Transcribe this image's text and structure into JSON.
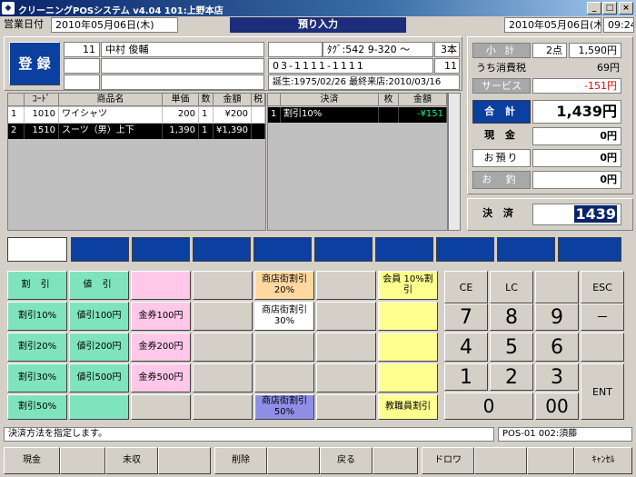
{
  "window": {
    "title": "クリーニングPOSシステム v4.04 101:上野本店",
    "min": "_",
    "max": "□",
    "close": "×"
  },
  "topbar": {
    "business_date_label": "営業日付",
    "business_date": "2010年05月06日(木)",
    "screen_title": "預り入力",
    "current_date": "2010年05月06日(木)",
    "time": "09:24"
  },
  "customer": {
    "register_label": "登 録",
    "number": "11",
    "name": "中村 俊輔",
    "tag_label": "ﾀｸﾞ:542 9-320 ～",
    "pieces": "3本",
    "phone": "03-1111-1111",
    "phone_ext": "11",
    "birth_last_visit": "誕生:1975/02/26 最終来店:2010/03/16"
  },
  "items_table": {
    "headers": [
      "ｺｰﾄﾞ",
      "商品名",
      "単価",
      "数",
      "金額",
      "税"
    ],
    "rows": [
      {
        "no": "1",
        "code": "1010",
        "name": "ワイシャツ",
        "price": "200",
        "qty": "1",
        "amount": "¥200",
        "tax": ""
      },
      {
        "no": "2",
        "code": "1510",
        "name": "スーツ（男）上下",
        "price": "1,390",
        "qty": "1",
        "amount": "¥1,390",
        "tax": ""
      }
    ]
  },
  "settle_table": {
    "headers": [
      "決済",
      "枚",
      "金額"
    ],
    "rows": [
      {
        "no": "1",
        "name": "割引10%",
        "count": "",
        "amount": "-¥151"
      }
    ]
  },
  "summary": {
    "subtotal_label": "小 計",
    "subtotal_pieces": "2点",
    "subtotal": "1,590円",
    "tax_label": "うち消費税",
    "tax": "69円",
    "service_label": "サービス",
    "service": "-151円",
    "total_label": "合 計",
    "total": "1,439円",
    "cash_label": "現 金",
    "cash": "0円",
    "deposit_label": "お預り",
    "deposit": "0円",
    "change_label": "お 釣",
    "change": "0円",
    "settle_label": "決 済",
    "settle_value": "1439"
  },
  "buttons": {
    "discount": "割 引",
    "value_discount": "値 引",
    "d10": "割引10%",
    "d20": "割引20%",
    "d30": "割引30%",
    "d50": "割引50%",
    "v100": "値引100円",
    "v200": "値引200円",
    "v500": "値引500円",
    "g100": "金券100円",
    "g200": "金券200円",
    "g500": "金券500円",
    "shop20": "商店街割引 20%",
    "shop30": "商店街割引 30%",
    "shop50": "商店街割引 50%",
    "member10": "会員 10%割引",
    "staff": "教職員割引"
  },
  "keypad": {
    "ce": "CE",
    "lc": "LC",
    "esc": "ESC",
    "minus": "－",
    "ent": "ENT",
    "n7": "7",
    "n8": "8",
    "n9": "9",
    "n4": "4",
    "n5": "5",
    "n6": "6",
    "n1": "1",
    "n2": "2",
    "n3": "3",
    "n0": "0",
    "n00": "00"
  },
  "status": {
    "message": "決済方法を指定します。",
    "terminal": "POS-01 002:須藤"
  },
  "fkeys": {
    "cash": "現金",
    "unpaid": "未収",
    "delete": "削除",
    "back": "戻る",
    "drawer": "ドロワ",
    "cancel": "ｷｬﾝｾﾙ"
  }
}
